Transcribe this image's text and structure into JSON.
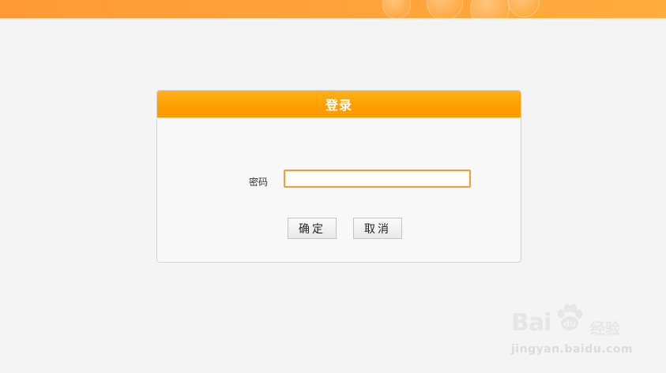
{
  "login_panel": {
    "title": "登录",
    "password_label": "密码",
    "password_value": "",
    "ok_button": "确定",
    "cancel_button": "取消"
  },
  "watermark": {
    "brand": "Bai",
    "brand_suffix": "经验",
    "url": "jingyan.baidu.com"
  },
  "colors": {
    "banner": "#ffa23a",
    "header": "#ff9f00",
    "input_border": "#f0a030",
    "background": "#f4f4f4"
  }
}
